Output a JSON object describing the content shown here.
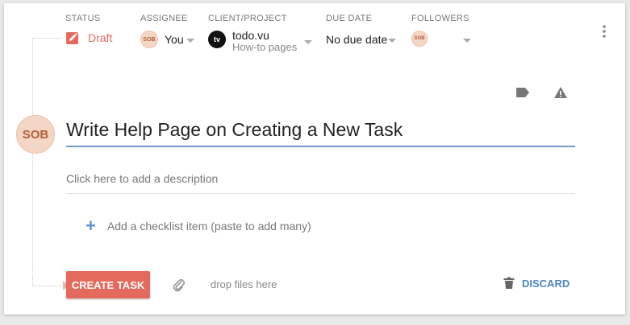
{
  "header": {
    "status_label": "STATUS",
    "assignee_label": "ASSIGNEE",
    "client_label": "CLIENT/PROJECT",
    "due_label": "DUE DATE",
    "followers_label": "FOLLOWERS"
  },
  "status": {
    "value": "Draft",
    "icon": "edit-square-icon",
    "color": "#e36a5d"
  },
  "assignee": {
    "initials": "SOB",
    "value": "You"
  },
  "client": {
    "logo_text": "tv",
    "name": "todo.vu",
    "project": "How-to pages"
  },
  "due": {
    "value": "No due date"
  },
  "followers": {
    "initials": "SOB"
  },
  "task": {
    "avatar_initials": "SOB",
    "title": "Write Help Page on Creating a New Task",
    "description_placeholder": "Click here to add a description",
    "checklist_placeholder": "Add a checklist item (paste to add many)"
  },
  "footer": {
    "create_label": "CREATE TASK",
    "drop_text": "drop files here",
    "discard_label": "DISCARD"
  },
  "colors": {
    "accent_red": "#e36a5d",
    "accent_blue": "#4e84bd",
    "title_underline": "#6f9ac7"
  }
}
